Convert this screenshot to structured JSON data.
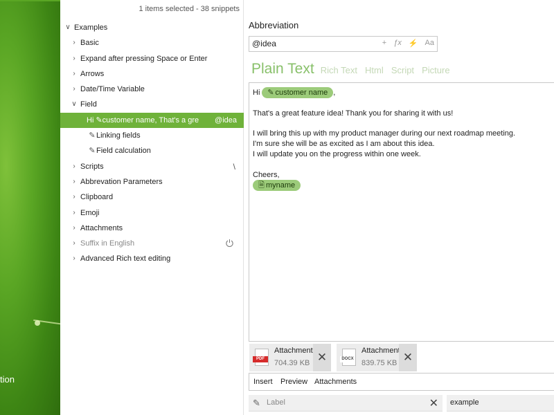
{
  "sidebar_text": "tion",
  "status": "1 items selected - 38 snippets",
  "tree": {
    "root_label": "Examples",
    "items": [
      {
        "label": "Basic"
      },
      {
        "label": "Expand after pressing Space or Enter"
      },
      {
        "label": "Arrows"
      },
      {
        "label": "Date/Time Variable"
      },
      {
        "label": "Field"
      },
      {
        "label": "Hi  ✎customer name,  That's a gre",
        "abbreviation": "@idea"
      },
      {
        "label": "Linking fields"
      },
      {
        "label": "Field calculation"
      },
      {
        "label": "Scripts",
        "marker": "\\"
      },
      {
        "label": "Abbrevation Parameters"
      },
      {
        "label": "Clipboard"
      },
      {
        "label": "Emoji"
      },
      {
        "label": "Attachments"
      },
      {
        "label": "Suffix in English"
      },
      {
        "label": "Advanced Rich text editing"
      }
    ]
  },
  "editor": {
    "abbreviation_title": "Abbreviation",
    "abbreviation_value": "@idea",
    "tools": [
      "+",
      "ƒx",
      "⚡",
      "Aa"
    ],
    "type_tabs": [
      "Plain Text",
      "Rich Text",
      "Html",
      "Script",
      "Picture"
    ],
    "content": {
      "hi": "Hi",
      "field_pill": "customer name",
      "comma": ",",
      "line2": "That's a great feature idea! Thank you for sharing it with us!",
      "line3": "I will bring this up with my product manager during our next roadmap meeting.",
      "line4": "I'm sure she will be as excited as I am about this idea.",
      "line5": "I will update you on the progress within one week.",
      "line6": "Cheers,",
      "myname_pill": "myname"
    },
    "attachments": [
      {
        "name": "Attachment",
        "size": "704.39 KB",
        "type": "PDF"
      },
      {
        "name": "Attachment",
        "size": "839.75 KB",
        "type": "DOCX"
      }
    ],
    "bottom_tabs": [
      "Insert",
      "Preview",
      "Attachments"
    ],
    "label_placeholder": "Label",
    "example_value": "example"
  }
}
